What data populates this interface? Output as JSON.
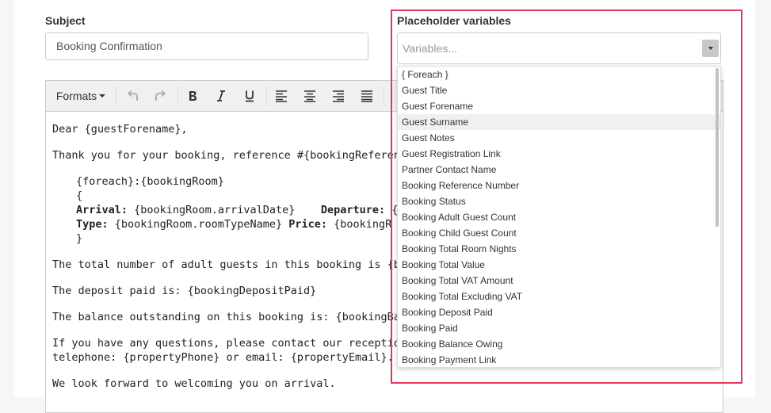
{
  "subject": {
    "label": "Subject",
    "value": "Booking Confirmation"
  },
  "toolbar": {
    "formats_label": "Formats",
    "icons": [
      "undo-icon",
      "redo-icon",
      "bold-icon",
      "italic-icon",
      "underline-icon",
      "align-left-icon",
      "align-center-icon",
      "align-right-icon",
      "align-justify-icon"
    ]
  },
  "body": {
    "line1": "Dear {guestForename},",
    "line2": "Thank you for your booking, reference #{bookingReferenceNu",
    "foreach_open": "{foreach}:{bookingRoom}",
    "brace_open": "{",
    "arrival_label": "Arrival:",
    "arrival_value": " {bookingRoom.arrivalDate}",
    "departure_label": "Departure:",
    "departure_value": " {boo",
    "type_label": "Type:",
    "type_value": " {bookingRoom.roomTypeName} ",
    "price_label": "Price:",
    "price_value": " {bookingR",
    "brace_close": "}",
    "line_adults": "The total number of adult guests in this booking is {bookingA",
    "line_deposit": "The deposit paid is: {bookingDepositPaid}",
    "line_balance": "The balance outstanding on this booking is: {bookingBalance(",
    "line_questions_1": "If you have any questions, please contact our reception team",
    "line_questions_2": "telephone: {propertyPhone} or email: {propertyEmail}.",
    "line_closing": "We look forward to welcoming you on arrival."
  },
  "placeholder": {
    "label": "Placeholder variables",
    "placeholder": "Variables...",
    "hovered_item": "Guest Surname",
    "items": [
      "{ Foreach }",
      "Guest Title",
      "Guest Forename",
      "Guest Surname",
      "Guest Notes",
      "Guest Registration Link",
      "Partner Contact Name",
      "Booking Reference Number",
      "Booking Status",
      "Booking Adult Guest Count",
      "Booking Child Guest Count",
      "Booking Total Room Nights",
      "Booking Total Value",
      "Booking Total VAT Amount",
      "Booking Total Excluding VAT",
      "Booking Deposit Paid",
      "Booking Paid",
      "Booking Balance Owing",
      "Booking Payment Link"
    ]
  },
  "colors": {
    "highlight_border": "#e0365a",
    "hover_row": "#f0f0f0"
  }
}
